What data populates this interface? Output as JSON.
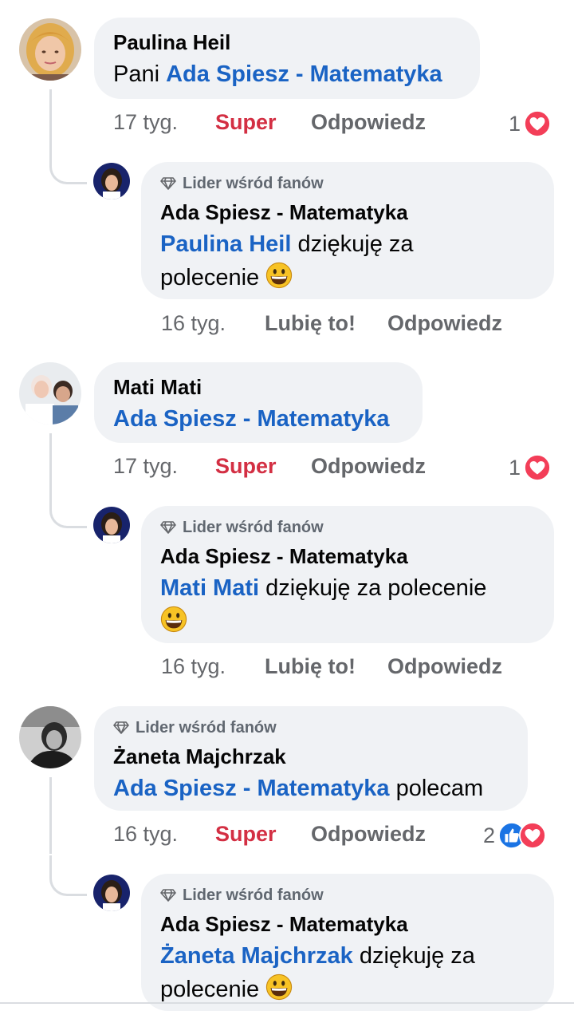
{
  "comments": [
    {
      "author": "Paulina Heil",
      "text_prefix": "Pani ",
      "mention": "Ada Spiesz - Matematyka",
      "time": "17 tyg.",
      "reaction_label": "Super",
      "reply_label": "Odpowiedz",
      "reaction_count": "1",
      "reply": {
        "badge": "Lider wśród fanów",
        "author": "Ada Spiesz - Matematyka",
        "mention": "Paulina Heil",
        "text_line1": " dziękuję za",
        "text_line2": "polecenie ",
        "time": "16 tyg.",
        "like_label": "Lubię to!",
        "reply_label": "Odpowiedz"
      }
    },
    {
      "author": "Mati Mati",
      "mention": "Ada Spiesz - Matematyka",
      "time": "17 tyg.",
      "reaction_label": "Super",
      "reply_label": "Odpowiedz",
      "reaction_count": "1",
      "reply": {
        "badge": "Lider wśród fanów",
        "author": "Ada Spiesz - Matematyka",
        "mention": "Mati Mati",
        "text_line1": " dziękuję za polecenie",
        "time": "16 tyg.",
        "like_label": "Lubię to!",
        "reply_label": "Odpowiedz"
      }
    },
    {
      "badge": "Lider wśród fanów",
      "author": "Żaneta Majchrzak",
      "mention": "Ada Spiesz - Matematyka",
      "text_suffix": " polecam",
      "time": "16 tyg.",
      "reaction_label": "Super",
      "reply_label": "Odpowiedz",
      "reaction_count": "2",
      "reply": {
        "badge": "Lider wśród fanów",
        "author": "Ada Spiesz - Matematyka",
        "mention": "Żaneta Majchrzak",
        "text_line1": " dziękuję za",
        "text_line2": "polecenie ",
        "time": "16 tyg.",
        "like_label": "Lubię to!",
        "reply_label": "Odpowiedz"
      }
    }
  ],
  "colors": {
    "bubble": "#f0f2f5",
    "mention": "#1a63c4",
    "super": "#d32f43",
    "meta": "#65676b"
  },
  "icons": [
    "diamond-icon",
    "heart-reaction-icon",
    "like-reaction-icon",
    "grinning-emoji-icon"
  ]
}
